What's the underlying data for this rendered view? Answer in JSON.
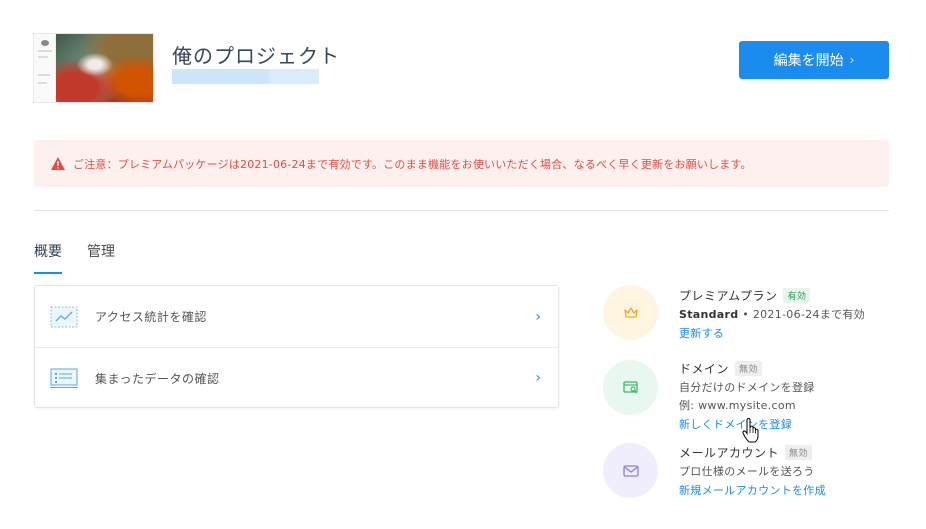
{
  "project": {
    "title": "俺のプロジェクト"
  },
  "header": {
    "edit_button_label": "編集を開始",
    "edit_button_chevron": "›"
  },
  "alert": {
    "text": "ご注意：プレミアムパッケージは2021-06-24まで有効です。このまま機能をお使いいただく場合、なるべく早く更新をお願いします。",
    "color": "#e54d42"
  },
  "tabs": [
    {
      "label": "概要",
      "active": true
    },
    {
      "label": "管理",
      "active": false
    }
  ],
  "list": [
    {
      "label": "アクセス統計を確認",
      "icon": "chart-icon",
      "arrow": "›"
    },
    {
      "label": "集まったデータの確認",
      "icon": "list-icon",
      "arrow": "›"
    }
  ],
  "features": {
    "premium": {
      "title": "プレミアムプラン",
      "badge": "有効",
      "plan": "Standard",
      "detail": " • 2021-06-24まで有効",
      "link": "更新する",
      "icon": "crown-icon"
    },
    "domain": {
      "title": "ドメイン",
      "badge": "無効",
      "line1": "自分だけのドメインを登録",
      "line2": "例: www.mysite.com",
      "link": "新しくドメインを登録",
      "icon": "domain-icon"
    },
    "mail": {
      "title": "メールアカウント",
      "badge": "無効",
      "line1": "プロ仕様のメールを送ろう",
      "link": "新規メールアカウントを作成",
      "icon": "mail-icon"
    }
  },
  "colors": {
    "accent": "#1a8cf0",
    "alert_bg": "#fdf0ef",
    "premium_bg": "#fff5e1",
    "domain_bg": "#e9f8ee",
    "mail_bg": "#f0eefc"
  }
}
